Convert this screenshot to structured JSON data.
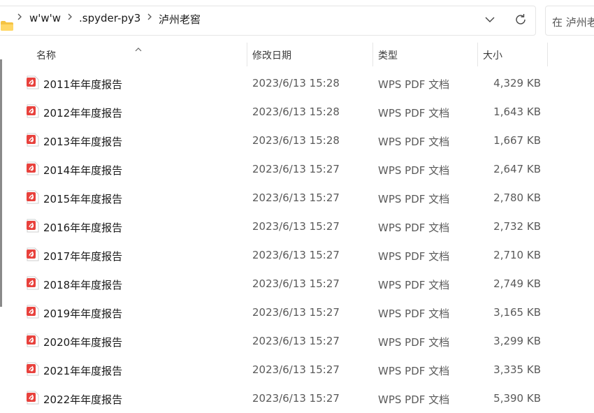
{
  "breadcrumb": {
    "items": [
      "w'w'w",
      ".spyder-py3",
      "泸州老窖"
    ]
  },
  "search": {
    "placeholder": "在 泸州老窖"
  },
  "columns": {
    "name": "名称",
    "modified": "修改日期",
    "type": "类型",
    "size": "大小"
  },
  "files": [
    {
      "name": "2011年年度报告",
      "modified": "2023/6/13 15:28",
      "type": "WPS PDF 文档",
      "size": "4,329 KB"
    },
    {
      "name": "2012年年度报告",
      "modified": "2023/6/13 15:28",
      "type": "WPS PDF 文档",
      "size": "1,643 KB"
    },
    {
      "name": "2013年年度报告",
      "modified": "2023/6/13 15:28",
      "type": "WPS PDF 文档",
      "size": "1,667 KB"
    },
    {
      "name": "2014年年度报告",
      "modified": "2023/6/13 15:27",
      "type": "WPS PDF 文档",
      "size": "2,647 KB"
    },
    {
      "name": "2015年年度报告",
      "modified": "2023/6/13 15:27",
      "type": "WPS PDF 文档",
      "size": "2,780 KB"
    },
    {
      "name": "2016年年度报告",
      "modified": "2023/6/13 15:27",
      "type": "WPS PDF 文档",
      "size": "2,732 KB"
    },
    {
      "name": "2017年年度报告",
      "modified": "2023/6/13 15:27",
      "type": "WPS PDF 文档",
      "size": "2,710 KB"
    },
    {
      "name": "2018年年度报告",
      "modified": "2023/6/13 15:27",
      "type": "WPS PDF 文档",
      "size": "2,749 KB"
    },
    {
      "name": "2019年年度报告",
      "modified": "2023/6/13 15:27",
      "type": "WPS PDF 文档",
      "size": "3,165 KB"
    },
    {
      "name": "2020年年度报告",
      "modified": "2023/6/13 15:27",
      "type": "WPS PDF 文档",
      "size": "3,299 KB"
    },
    {
      "name": "2021年年度报告",
      "modified": "2023/6/13 15:27",
      "type": "WPS PDF 文档",
      "size": "3,335 KB"
    },
    {
      "name": "2022年年度报告",
      "modified": "2023/6/13 15:27",
      "type": "WPS PDF 文档",
      "size": "5,390 KB"
    }
  ],
  "icons": {
    "folder": "folder-icon",
    "chevron": "chevron-right-icon",
    "dropdown": "chevron-down-icon",
    "refresh": "refresh-icon",
    "file": "wps-pdf-icon",
    "sort": "sort-up-icon"
  },
  "colors": {
    "pdf_icon": "#e8413c",
    "folder": "#f5c342"
  }
}
